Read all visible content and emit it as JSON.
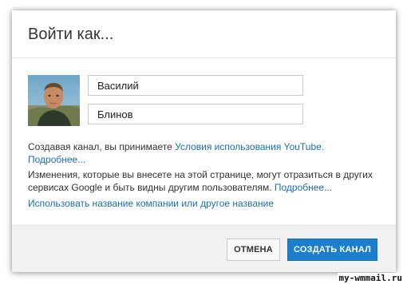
{
  "dialog": {
    "title": "Войти как...",
    "first_name": {
      "value": "Василий",
      "placeholder": ""
    },
    "last_name": {
      "value": "Блинов",
      "placeholder": ""
    },
    "terms": {
      "text": "Создавая канал, вы принимаете ",
      "link": "Условия использования YouTube.",
      "more": "Подробнее..."
    },
    "changes": {
      "text": "Изменения, которые вы внесете на этой странице, могут отразиться в других сервисах Google и быть видны другим пользователям. ",
      "more": "Подробнее..."
    },
    "use_business_name": "Использовать название компании или другое название",
    "cancel_label": "ОТМЕНА",
    "create_label": "СОЗДАТЬ КАНАЛ"
  },
  "colors": {
    "link": "#1a6fbf",
    "primary_button": "#1b7fcc",
    "footer_bg": "#f1f1f1"
  },
  "watermark": "my-wmmail.ru"
}
